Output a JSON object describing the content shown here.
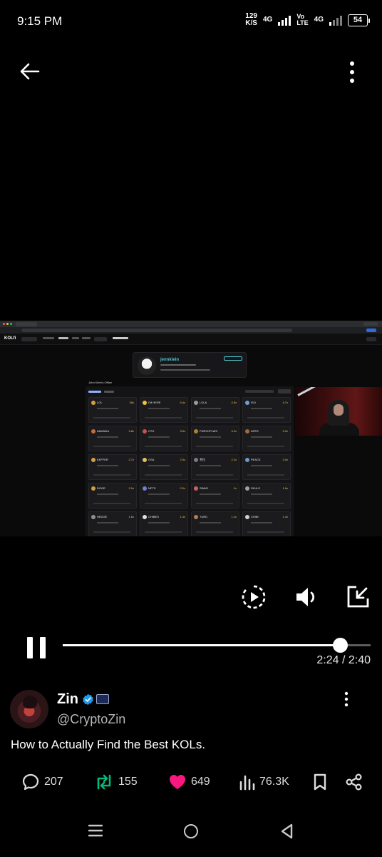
{
  "status": {
    "time": "9:15 PM",
    "net_speed_value": "129",
    "net_speed_unit": "K/S",
    "network1": "4G",
    "volte_top": "Vo",
    "volte_bottom": "LTE",
    "network2": "4G",
    "battery": "54"
  },
  "video": {
    "app_logo": "KOLfi",
    "profile_name": "jennklein",
    "office_label": "John Klein's Office",
    "tiles": [
      {
        "name": "LOL",
        "mult": "38x",
        "color": "#d8a03a"
      },
      {
        "name": "I'M HERE",
        "mult": "9.4x",
        "color": "#f0c040"
      },
      {
        "name": "LOLA",
        "mult": "4.9x",
        "color": "#9a9a9a"
      },
      {
        "name": "ISO",
        "mult": "4.7x",
        "color": "#6aa0d8"
      },
      {
        "name": "AMANDA",
        "mult": "3.8x",
        "color": "#c07040"
      },
      {
        "name": "CTO",
        "mult": "3.5x",
        "color": "#d05050"
      },
      {
        "name": "PURCHFLWS",
        "mult": "3.2x",
        "color": "#b08030"
      },
      {
        "name": "APES",
        "mult": "3.2x",
        "color": "#a06a40"
      },
      {
        "name": "KEFFER",
        "mult": "2.7x",
        "color": "#d0a050"
      },
      {
        "name": "OSA",
        "mult": "2.5x",
        "color": "#e0c060"
      },
      {
        "name": "考拉",
        "mult": "2.2x",
        "color": "#7a7a7a"
      },
      {
        "name": "PEACE",
        "mult": "2.0x",
        "color": "#6a9ad0"
      },
      {
        "name": "DOGE",
        "mult": "2.0x",
        "color": "#d0a040"
      },
      {
        "name": "NFTS",
        "mult": "2.0x",
        "color": "#7080d0"
      },
      {
        "name": "SWAD",
        "mult": "2x",
        "color": "#d06060"
      },
      {
        "name": "SKULE",
        "mult": "1.6x",
        "color": "#a0a0a0"
      },
      {
        "name": "HEDGE",
        "mult": "1.6x",
        "color": "#909090"
      },
      {
        "name": "CHIBES",
        "mult": "1.4x",
        "color": "#e0e0e0"
      },
      {
        "name": "TURD",
        "mult": "1.4x",
        "color": "#b08050"
      },
      {
        "name": "CHIBI",
        "mult": "1.4x",
        "color": "#d0d0d0"
      }
    ]
  },
  "player": {
    "progress_percent": 90,
    "time_readout": "2:24 / 2:40"
  },
  "post": {
    "author": "Zin",
    "handle": "@CryptoZin",
    "text": "How to Actually Find the Best KOLs.",
    "replies": "207",
    "reposts": "155",
    "likes": "649",
    "views": "76.3K",
    "like_color": "#f91880",
    "repost_color": "#00ba7c",
    "verified_color": "#1d9bf0"
  }
}
